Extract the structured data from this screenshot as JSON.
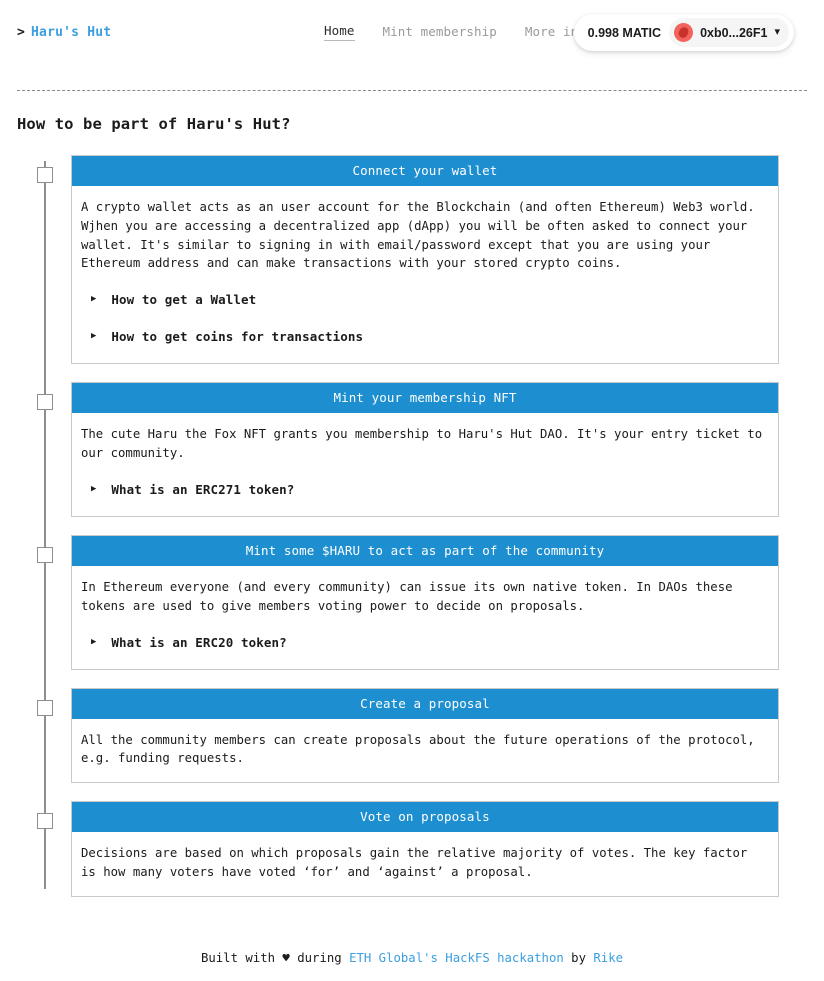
{
  "header": {
    "brand_chevron": ">",
    "brand_name": "Haru's Hut",
    "nav": [
      {
        "label": "Home",
        "active": true
      },
      {
        "label": "Mint membership",
        "active": false
      },
      {
        "label": "More info",
        "active": false
      }
    ],
    "wallet": {
      "balance": "0.998 MATIC",
      "address": "0xb0...26F1",
      "caret": "⌄",
      "avatar_color": "#f2635c"
    }
  },
  "page": {
    "title": "How to be part of Haru's Hut?"
  },
  "steps": [
    {
      "title": "Connect your wallet",
      "text": "A crypto wallet acts as an user account for the Blockchain (and often Ethereum) Web3 world. Wjhen you are accessing a decentralized app (dApp) you will be often asked to connect your wallet. It's similar to signing in with email/password except that you are using your Ethereum address and can make transactions with your stored crypto coins.",
      "disclosures": [
        {
          "arrow": "▶",
          "label": "How to get a Wallet"
        },
        {
          "arrow": "▶",
          "label": "How to get coins for transactions"
        }
      ]
    },
    {
      "title": "Mint your membership NFT",
      "text": "The cute Haru the Fox NFT grants you membership to Haru's Hut DAO. It's your entry ticket to our community.",
      "disclosures": [
        {
          "arrow": "▶",
          "label": "What is an ERC271 token?"
        }
      ]
    },
    {
      "title": "Mint some $HARU to act as part of the community",
      "text": "In Ethereum everyone (and every community) can issue its own native token. In DAOs these tokens are used to give members voting power to decide on proposals.",
      "disclosures": [
        {
          "arrow": "▶",
          "label": "What is an ERC20 token?"
        }
      ]
    },
    {
      "title": "Create a proposal",
      "text": "All the community members can create proposals about the future operations of the protocol, e.g. funding requests.",
      "disclosures": []
    },
    {
      "title": "Vote on proposals",
      "text": "Decisions are based on which proposals gain the relative majority of votes. The key factor is how many voters have voted ‘for’ and ‘against’ a proposal.",
      "disclosures": []
    }
  ],
  "footer": {
    "built_with": "Built with",
    "heart": "♥",
    "during": "during",
    "event_link": "ETH Global's HackFS hackathon",
    "by": "by",
    "author_link": "Rike"
  },
  "colors": {
    "accent_blue": "#1d8fd1",
    "link_blue": "#3b9fe0",
    "timeline_gray": "#8e8e8e",
    "card_border": "#c9c9c9"
  }
}
